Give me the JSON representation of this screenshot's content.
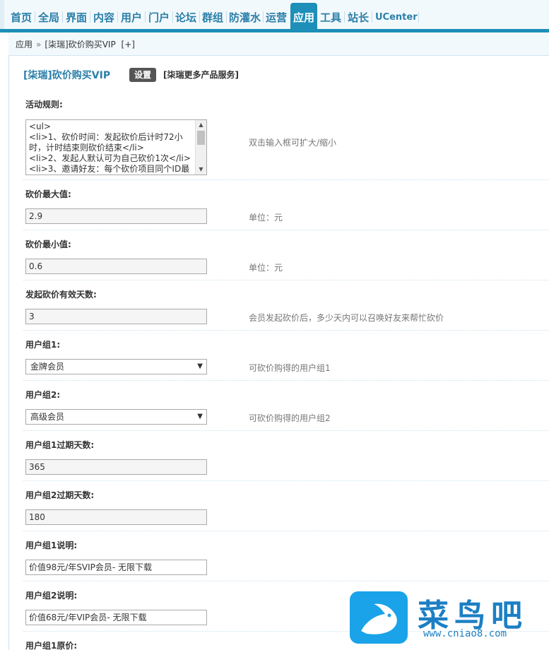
{
  "nav": {
    "items": [
      "首页",
      "全局",
      "界面",
      "内容",
      "用户",
      "门户",
      "论坛",
      "群组",
      "防灌水",
      "运营",
      "应用",
      "工具",
      "站长",
      "UCenter"
    ],
    "active_index": 10
  },
  "breadcrumb": {
    "root": "应用",
    "separator": "»",
    "current": "[柒瑞]砍价购买VIP",
    "add": "[+]"
  },
  "header": {
    "title": "[柒瑞]砍价购买VIP",
    "settings_label": "设置",
    "more_link": "[柒瑞更多产品服务]"
  },
  "form": {
    "rules": {
      "label": "活动规则:",
      "lines": [
        "<ul>",
        "<li>1、砍价时间：发起砍价后计时72小时，计时结束则砍价结束</li>",
        "<li>2、发起人默认可为自己砍价1次</li>",
        "<li>3、邀请好友：每个砍价项目同个ID最"
      ],
      "hint": "双击输入框可扩大/缩小"
    },
    "max_price": {
      "label": "砍价最大值:",
      "value": "2.9",
      "hint": "单位：元"
    },
    "min_price": {
      "label": "砍价最小值:",
      "value": "0.6",
      "hint": "单位：元"
    },
    "valid_days": {
      "label": "发起砍价有效天数:",
      "value": "3",
      "hint": "会员发起砍价后，多少天内可以召唤好友来帮忙砍价"
    },
    "group1": {
      "label": "用户组1:",
      "selected": "金牌会员",
      "hint": "可砍价购得的用户组1"
    },
    "group2": {
      "label": "用户组2:",
      "selected": "高级会员",
      "hint": "可砍价购得的用户组2"
    },
    "group1_expire": {
      "label": "用户组1过期天数:",
      "value": "365"
    },
    "group2_expire": {
      "label": "用户组2过期天数:",
      "value": "180"
    },
    "group1_desc": {
      "label": "用户组1说明:",
      "value": "价值98元/年SVIP会员- 无限下载"
    },
    "group2_desc": {
      "label": "用户组2说明:",
      "value": "价值68元/年VIP会员- 无限下载"
    },
    "group1_price": {
      "label": "用户组1原价:"
    }
  },
  "watermark": {
    "text": "菜鸟吧",
    "url": "www.cniao8.com"
  },
  "colors": {
    "accent": "#1d8fb8",
    "link": "#2b7fa8",
    "nav_bg": "#f2f9fd"
  }
}
